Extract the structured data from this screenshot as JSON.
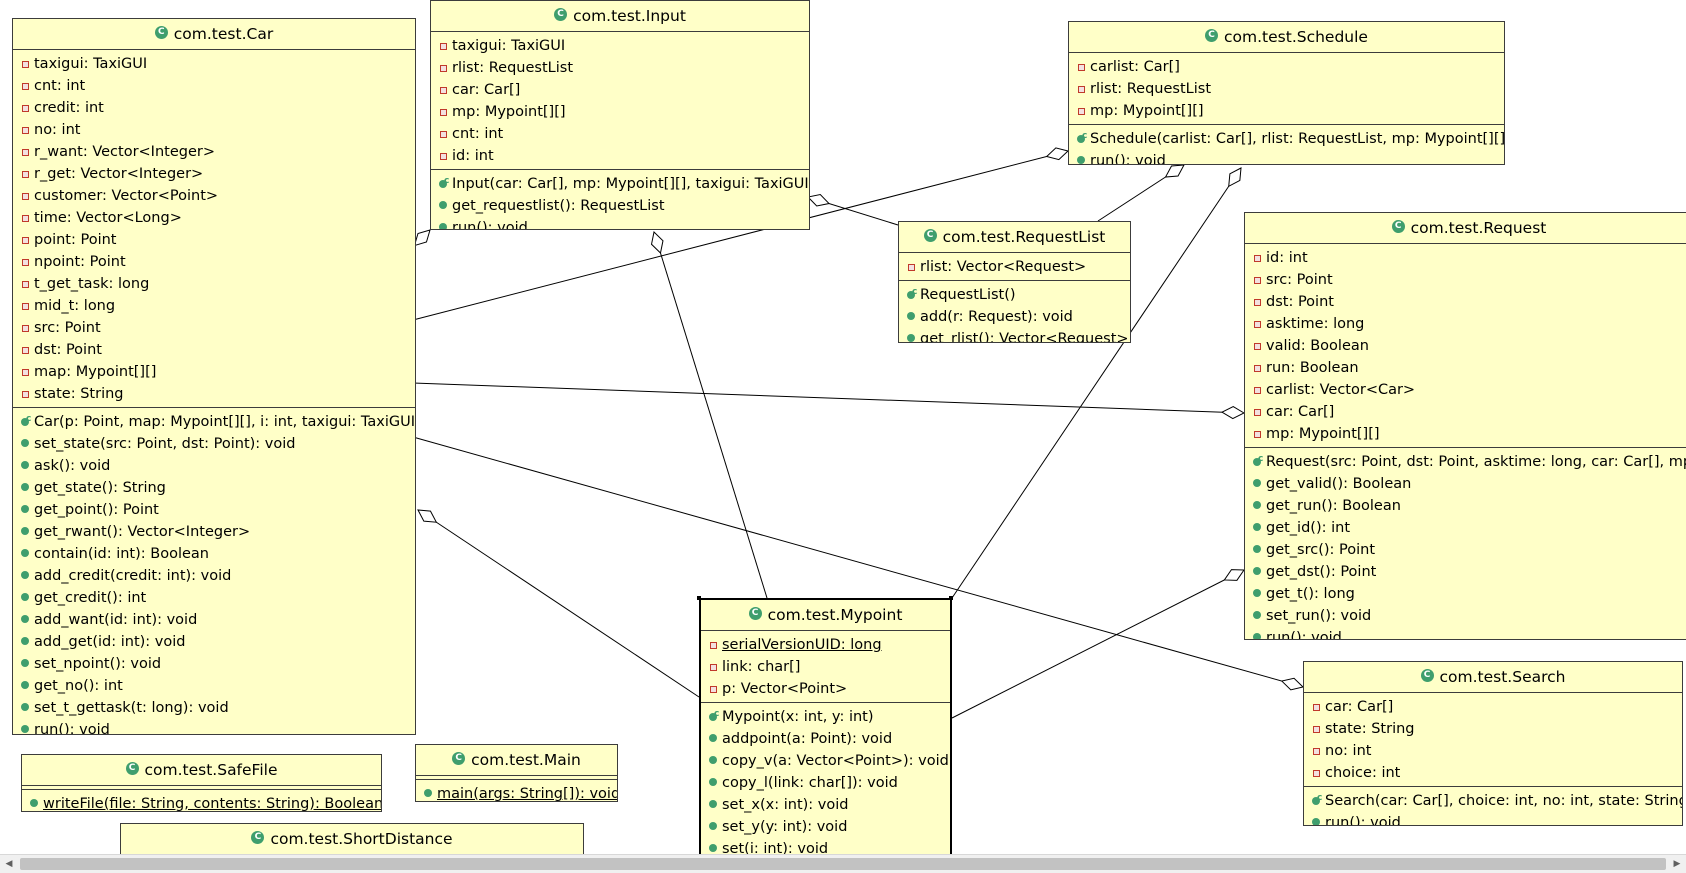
{
  "diagram": {
    "classes": {
      "car": {
        "name": "com.test.Car",
        "fields": [
          {
            "vis": "private",
            "text": "taxigui: TaxiGUI"
          },
          {
            "vis": "private",
            "text": "cnt: int"
          },
          {
            "vis": "private",
            "text": "credit: int"
          },
          {
            "vis": "private",
            "text": "no: int"
          },
          {
            "vis": "private",
            "text": "r_want: Vector<Integer>"
          },
          {
            "vis": "private",
            "text": "r_get: Vector<Integer>"
          },
          {
            "vis": "private",
            "text": "customer: Vector<Point>"
          },
          {
            "vis": "private",
            "text": "time: Vector<Long>"
          },
          {
            "vis": "private",
            "text": "point: Point"
          },
          {
            "vis": "private",
            "text": "npoint: Point"
          },
          {
            "vis": "private",
            "text": "t_get_task: long"
          },
          {
            "vis": "private",
            "text": "mid_t: long"
          },
          {
            "vis": "private",
            "text": "src: Point"
          },
          {
            "vis": "private",
            "text": "dst: Point"
          },
          {
            "vis": "private",
            "text": "map: Mypoint[][]"
          },
          {
            "vis": "private",
            "text": "state: String"
          }
        ],
        "methods": [
          {
            "vis": "ctor",
            "text": "Car(p: Point, map: Mypoint[][], i: int, taxigui: TaxiGUI)"
          },
          {
            "vis": "public",
            "text": "set_state(src: Point, dst: Point): void"
          },
          {
            "vis": "public",
            "text": "ask(): void"
          },
          {
            "vis": "public",
            "text": "get_state(): String"
          },
          {
            "vis": "public",
            "text": "get_point(): Point"
          },
          {
            "vis": "public",
            "text": "get_rwant(): Vector<Integer>"
          },
          {
            "vis": "public",
            "text": "contain(id: int): Boolean"
          },
          {
            "vis": "public",
            "text": "add_credit(credit: int): void"
          },
          {
            "vis": "public",
            "text": "get_credit(): int"
          },
          {
            "vis": "public",
            "text": "add_want(id: int): void"
          },
          {
            "vis": "public",
            "text": "add_get(id: int): void"
          },
          {
            "vis": "public",
            "text": "set_npoint(): void"
          },
          {
            "vis": "public",
            "text": "get_no(): int"
          },
          {
            "vis": "public",
            "text": "set_t_gettask(t: long): void"
          },
          {
            "vis": "public",
            "text": "run(): void"
          }
        ]
      },
      "input": {
        "name": "com.test.Input",
        "fields": [
          {
            "vis": "private",
            "text": "taxigui: TaxiGUI"
          },
          {
            "vis": "private",
            "text": "rlist: RequestList"
          },
          {
            "vis": "private",
            "text": "car: Car[]"
          },
          {
            "vis": "private",
            "text": "mp: Mypoint[][]"
          },
          {
            "vis": "private",
            "text": "cnt: int"
          },
          {
            "vis": "private",
            "text": "id: int"
          }
        ],
        "methods": [
          {
            "vis": "ctor",
            "text": "Input(car: Car[], mp: Mypoint[][], taxigui: TaxiGUI)"
          },
          {
            "vis": "public",
            "text": "get_requestlist(): RequestList"
          },
          {
            "vis": "public",
            "text": "run(): void"
          }
        ]
      },
      "schedule": {
        "name": "com.test.Schedule",
        "fields": [
          {
            "vis": "private",
            "text": "carlist: Car[]"
          },
          {
            "vis": "private",
            "text": "rlist: RequestList"
          },
          {
            "vis": "private",
            "text": "mp: Mypoint[][]"
          }
        ],
        "methods": [
          {
            "vis": "ctor",
            "text": "Schedule(carlist: Car[], rlist: RequestList, mp: Mypoint[][])"
          },
          {
            "vis": "public",
            "text": "run(): void"
          }
        ]
      },
      "requestlist": {
        "name": "com.test.RequestList",
        "fields": [
          {
            "vis": "private",
            "text": "rlist: Vector<Request>"
          }
        ],
        "methods": [
          {
            "vis": "ctor",
            "text": "RequestList()"
          },
          {
            "vis": "public",
            "text": "add(r: Request): void"
          },
          {
            "vis": "public",
            "text": "get_rlist(): Vector<Request>"
          }
        ]
      },
      "request": {
        "name": "com.test.Request",
        "fields": [
          {
            "vis": "private",
            "text": "id: int"
          },
          {
            "vis": "private",
            "text": "src: Point"
          },
          {
            "vis": "private",
            "text": "dst: Point"
          },
          {
            "vis": "private",
            "text": "asktime: long"
          },
          {
            "vis": "private",
            "text": "valid: Boolean"
          },
          {
            "vis": "private",
            "text": "run: Boolean"
          },
          {
            "vis": "private",
            "text": "carlist: Vector<Car>"
          },
          {
            "vis": "private",
            "text": "car: Car[]"
          },
          {
            "vis": "private",
            "text": "mp: Mypoint[][]"
          }
        ],
        "methods": [
          {
            "vis": "ctor",
            "text": "Request(src: Point, dst: Point, asktime: long, car: Car[], mp"
          },
          {
            "vis": "public",
            "text": "get_valid(): Boolean"
          },
          {
            "vis": "public",
            "text": "get_run(): Boolean"
          },
          {
            "vis": "public",
            "text": "get_id(): int"
          },
          {
            "vis": "public",
            "text": "get_src(): Point"
          },
          {
            "vis": "public",
            "text": "get_dst(): Point"
          },
          {
            "vis": "public",
            "text": "get_t(): long"
          },
          {
            "vis": "public",
            "text": "set_run(): void"
          },
          {
            "vis": "public",
            "text": "run(): void"
          }
        ]
      },
      "mypoint": {
        "name": "com.test.Mypoint",
        "fields": [
          {
            "vis": "private",
            "static": true,
            "text": "serialVersionUID: long"
          },
          {
            "vis": "private",
            "text": "link: char[]"
          },
          {
            "vis": "private",
            "text": "p: Vector<Point>"
          }
        ],
        "methods": [
          {
            "vis": "ctor",
            "text": "Mypoint(x: int, y: int)"
          },
          {
            "vis": "public",
            "text": "addpoint(a: Point): void"
          },
          {
            "vis": "public",
            "text": "copy_v(a: Vector<Point>): void"
          },
          {
            "vis": "public",
            "text": "copy_l(link: char[]): void"
          },
          {
            "vis": "public",
            "text": "set_x(x: int): void"
          },
          {
            "vis": "public",
            "text": "set_y(y: int): void"
          },
          {
            "vis": "public",
            "text": "set(i: int): void"
          }
        ]
      },
      "search": {
        "name": "com.test.Search",
        "fields": [
          {
            "vis": "private",
            "text": "car: Car[]"
          },
          {
            "vis": "private",
            "text": "state: String"
          },
          {
            "vis": "private",
            "text": "no: int"
          },
          {
            "vis": "private",
            "text": "choice: int"
          }
        ],
        "methods": [
          {
            "vis": "ctor",
            "text": "Search(car: Car[], choice: int, no: int, state: String)"
          },
          {
            "vis": "public",
            "text": "run(): void"
          }
        ]
      },
      "safefile": {
        "name": "com.test.SafeFile",
        "fields": [],
        "methods": [
          {
            "vis": "public",
            "static": true,
            "text": "writeFile(file: String, contents: String): Boolean"
          }
        ]
      },
      "main": {
        "name": "com.test.Main",
        "fields": [],
        "methods": [
          {
            "vis": "public",
            "static": true,
            "text": "main(args: String[]): void"
          }
        ]
      },
      "shortdistance": {
        "name": "com.test.ShortDistance",
        "fields": [],
        "methods": []
      }
    },
    "icons": {
      "class": "class-icon",
      "private": "private-field-icon",
      "public": "public-method-icon",
      "ctor": "constructor-icon"
    },
    "colors": {
      "box_fill": "#ffffc8",
      "border": "#3c3c3c",
      "class_icon": "#3f9e6d",
      "private_icon": "#c0392b",
      "canvas": "#ffffff"
    }
  }
}
